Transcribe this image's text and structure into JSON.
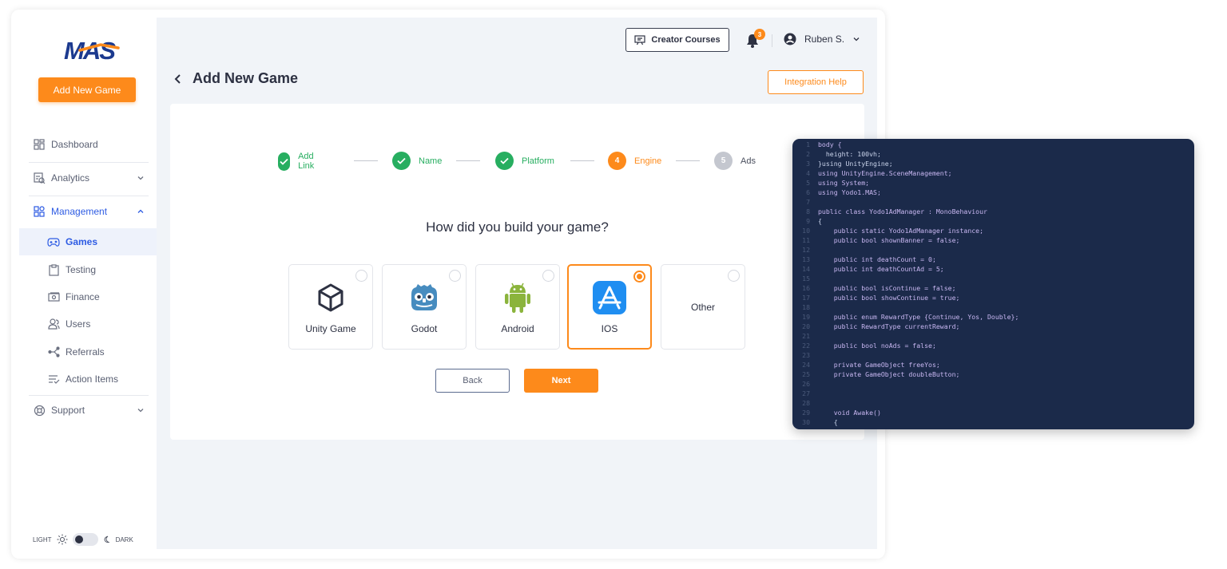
{
  "app": {
    "logo_text": "MAS"
  },
  "sidebar": {
    "add_button": "Add New Game",
    "items": [
      {
        "label": "Dashboard",
        "icon": "dashboard-icon"
      },
      {
        "label": "Analytics",
        "icon": "analytics-icon"
      },
      {
        "label": "Management",
        "icon": "management-icon"
      },
      {
        "label": "Games",
        "icon": "gamepad-icon"
      },
      {
        "label": "Testing",
        "icon": "clipboard-icon"
      },
      {
        "label": "Finance",
        "icon": "money-icon"
      },
      {
        "label": "Users",
        "icon": "users-icon"
      },
      {
        "label": "Referrals",
        "icon": "share-icon"
      },
      {
        "label": "Action Items",
        "icon": "checklist-icon"
      },
      {
        "label": "Support",
        "icon": "support-icon"
      }
    ],
    "theme": {
      "light": "LIGHT",
      "dark": "DARK"
    }
  },
  "header": {
    "creator_courses": "Creator Courses",
    "notification_count": "3",
    "user_name": "Ruben S."
  },
  "page": {
    "title": "Add New Game",
    "integration_help": "Integration Help"
  },
  "steps": [
    {
      "label": "Add Link",
      "state": "done",
      "number": "1"
    },
    {
      "label": "Name",
      "state": "done",
      "number": "2"
    },
    {
      "label": "Platform",
      "state": "done",
      "number": "3"
    },
    {
      "label": "Engine",
      "state": "current",
      "number": "4"
    },
    {
      "label": "Ads",
      "state": "todo",
      "number": "5"
    }
  ],
  "question": "How did you build your game?",
  "options": [
    {
      "label": "Unity Game",
      "icon": "unity-icon",
      "selected": false
    },
    {
      "label": "Godot",
      "icon": "godot-icon",
      "selected": false
    },
    {
      "label": "Android",
      "icon": "android-icon",
      "selected": false
    },
    {
      "label": "IOS",
      "icon": "app-store-icon",
      "selected": true
    },
    {
      "label": "Other",
      "icon": "",
      "selected": false
    }
  ],
  "buttons": {
    "back": "Back",
    "next": "Next"
  },
  "code": {
    "line_numbers": [
      "1",
      "2",
      "3",
      "4",
      "5",
      "6",
      "7",
      "8",
      "9",
      "10",
      "11",
      "12",
      "13",
      "14",
      "15",
      "16",
      "17",
      "18",
      "19",
      "20",
      "21",
      "22",
      "23",
      "24",
      "25",
      "26",
      "27",
      "28",
      "29",
      "30"
    ],
    "lines": [
      "body {",
      "  height: 100vh;",
      "}using UnityEngine;",
      "using UnityEngine.SceneManagement;",
      "using System;",
      "using Yodo1.MAS;",
      "",
      "public class Yodo1AdManager : MonoBehaviour",
      "{",
      "    public static Yodo1AdManager instance;",
      "    public bool shownBanner = false;",
      "",
      "    public int deathCount = 0;",
      "    public int deathCountAd = 5;",
      "",
      "    public bool isContinue = false;",
      "    public bool showContinue = true;",
      "",
      "    public enum RewardType {Continue, Yos, Double};",
      "    public RewardType currentReward;",
      "",
      "    public bool noAds = false;",
      "",
      "    private GameObject freeYos;",
      "    private GameObject doubleButton;",
      "",
      "",
      "",
      "    void Awake()",
      "    {"
    ]
  }
}
